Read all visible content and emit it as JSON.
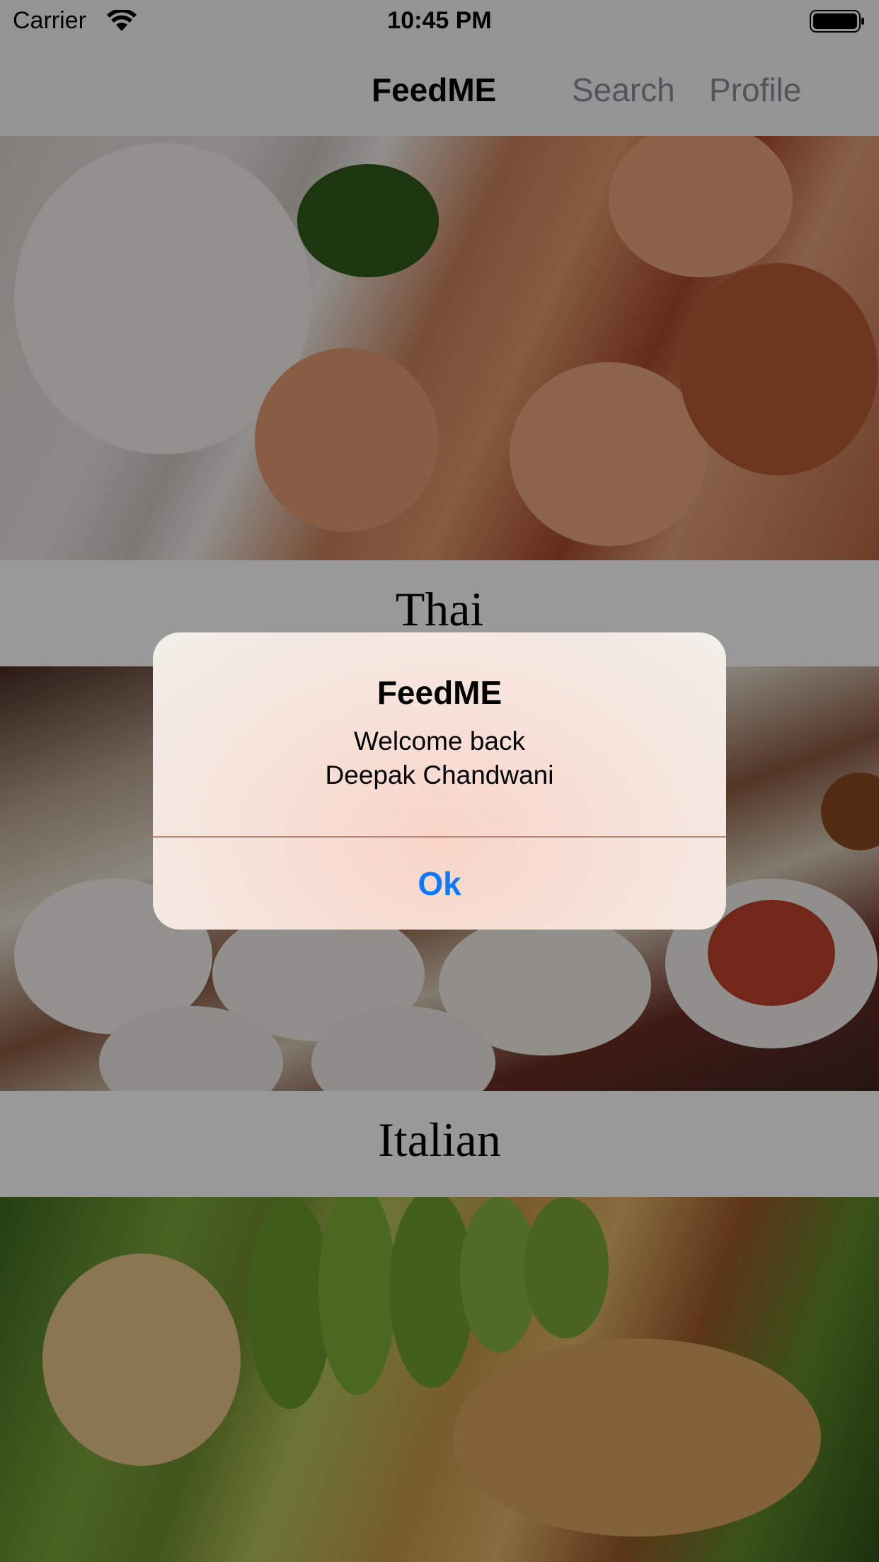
{
  "status_bar": {
    "carrier": "Carrier",
    "time": "10:45 PM",
    "icons": [
      "wifi-icon",
      "battery-icon"
    ]
  },
  "nav": {
    "title": "FeedME",
    "search_label": "Search",
    "profile_label": "Profile"
  },
  "cuisines": [
    {
      "label": "Thai",
      "image": "thai-food-image"
    },
    {
      "label": "Italian",
      "image": "italian-food-image"
    },
    {
      "label": "",
      "image": "salad-food-image"
    }
  ],
  "alert": {
    "title": "FeedME",
    "message": "Welcome back\nDeepak Chandwani",
    "button_label": "Ok"
  },
  "colors": {
    "nav_background": "#f7f7f7",
    "inactive_tab": "#8e8e93",
    "alert_button": "#0a7aff",
    "dim_overlay": "rgba(0,0,0,0.4)"
  }
}
